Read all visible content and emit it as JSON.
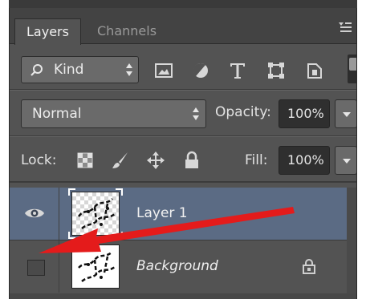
{
  "tabs": [
    {
      "label": "Layers",
      "active": true
    },
    {
      "label": "Channels",
      "active": false
    }
  ],
  "filter": {
    "kind_label": "Kind",
    "icons": [
      "image-filter-icon",
      "adjustment-filter-icon",
      "type-filter-icon",
      "shape-filter-icon",
      "smart-object-filter-icon"
    ]
  },
  "blend": {
    "mode": "Normal",
    "opacity_label": "Opacity:",
    "opacity_value": "100%"
  },
  "lock": {
    "label": "Lock:",
    "icons": [
      "lock-transparent-icon",
      "lock-image-icon",
      "lock-position-icon",
      "lock-all-icon"
    ],
    "fill_label": "Fill:",
    "fill_value": "100%"
  },
  "layers": [
    {
      "name": "Layer 1",
      "visible": true,
      "selected": true,
      "locked": false
    },
    {
      "name": "Background",
      "visible": false,
      "selected": false,
      "locked": true
    }
  ],
  "colors": {
    "panel_bg": "#535353",
    "selected_row": "#5b6b84",
    "annotation_arrow": "#e41b1b"
  }
}
